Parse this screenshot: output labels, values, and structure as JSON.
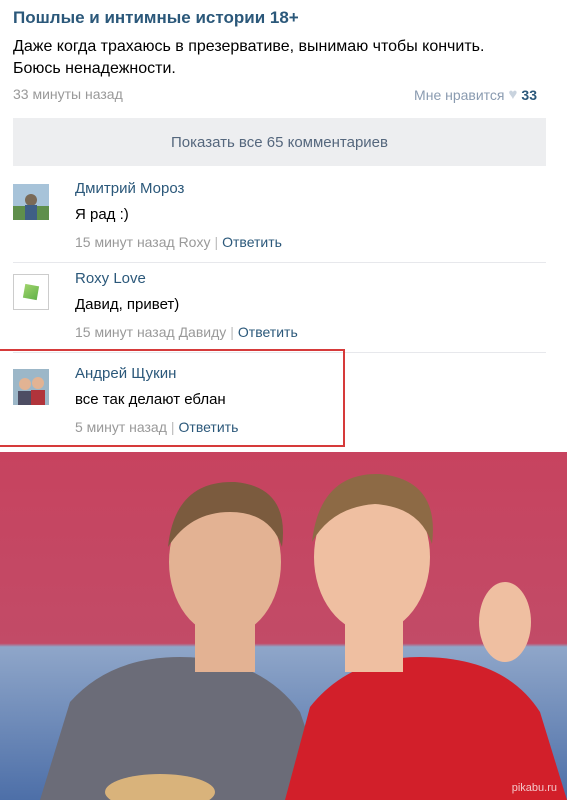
{
  "post": {
    "group": "Пошлые и интимные истории 18+",
    "text": "Даже когда трахаюсь в презервативе, вынимаю чтобы кончить. Боюсь ненадежности.",
    "time": "33 минуты назад",
    "like_label": "Мне нравится",
    "like_count": "33",
    "show_all": "Показать все 65 комментариев"
  },
  "comments": [
    {
      "name": "Дмитрий Мороз",
      "text": "Я рад :)",
      "time": "15 минут назад Roxy",
      "reply": "Ответить"
    },
    {
      "name": "Roxy Love",
      "text": "Давид, привет)",
      "time": "15 минут назад Давиду",
      "reply": "Ответить"
    },
    {
      "name": "Андрей Щукин",
      "text": "все так делают еблан",
      "time": "5 минут назад",
      "reply": "Ответить"
    }
  ],
  "watermark": "pikabu.ru",
  "colors": {
    "link": "#2b587a",
    "highlight": "#d63a3a",
    "photo_bg": "#b9425e"
  }
}
